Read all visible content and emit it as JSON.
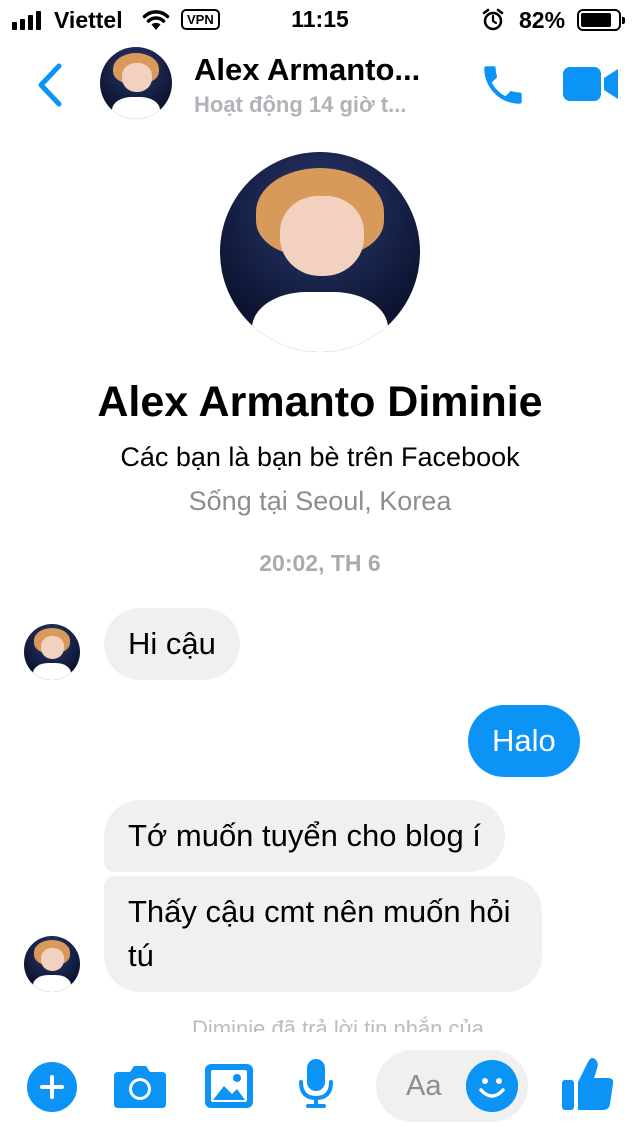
{
  "status_bar": {
    "carrier": "Viettel",
    "vpn": "VPN",
    "time": "11:15",
    "battery": "82%"
  },
  "header": {
    "name": "Alex Armanto...",
    "status": "Hoạt động 14 giờ t..."
  },
  "profile": {
    "name": "Alex Armanto Diminie",
    "friends_note": "Các bạn là bạn bè trên Facebook",
    "location": "Sống tại Seoul, Korea"
  },
  "timestamp": "20:02, TH 6",
  "messages": [
    {
      "direction": "incoming",
      "text": "Hi cậu"
    },
    {
      "direction": "outgoing",
      "text": "Halo"
    },
    {
      "direction": "incoming",
      "text": "Tớ muốn tuyển cho blog í"
    },
    {
      "direction": "incoming",
      "text": "Thấy cậu cmt nên muốn hỏi tú"
    }
  ],
  "read_receipt": "Diminie đã trả lời tin nhắn của",
  "composer": {
    "placeholder": "Aa"
  },
  "colors": {
    "accent": "#0b93f6",
    "incoming_bubble": "#f0f0f0",
    "secondary_text": "#8a8d91"
  },
  "icons": [
    "back-chevron-icon",
    "phone-icon",
    "video-camera-icon",
    "plus-icon",
    "camera-icon",
    "image-icon",
    "microphone-icon",
    "emoji-icon",
    "thumbs-up-icon",
    "wifi-icon",
    "alarm-icon"
  ]
}
